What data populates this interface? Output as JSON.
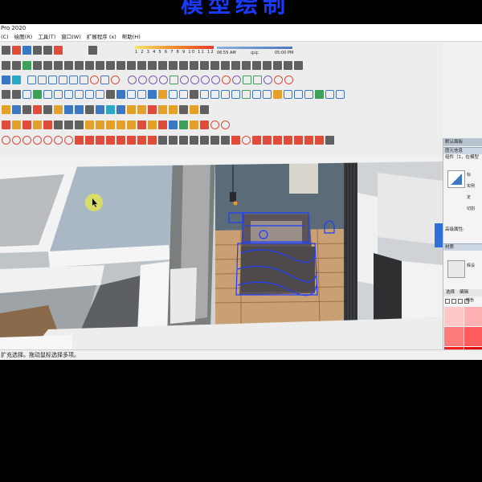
{
  "banner": {
    "text": "模型绘制"
  },
  "window": {
    "title": "Pro 2020"
  },
  "menu": [
    {
      "label": "(C)"
    },
    {
      "label": "绘图(R)"
    },
    {
      "label": "工具(T)"
    },
    {
      "label": "窗口(W)"
    },
    {
      "label": "扩展程序 (x)"
    },
    {
      "label": "帮助(H)"
    }
  ],
  "shadow": {
    "months": "1 2 3 4 5 6 7 8 9 10 11 12",
    "time_start": "06:55 AM",
    "noon": "中午",
    "time_end": "05:00 PM"
  },
  "status": {
    "text": "扩充选择。拖动鼠标选择多项。"
  },
  "tray": {
    "title": "默认面板",
    "entity_section": "图元信息",
    "component_label": "组件（1，在模型",
    "side_labels": [
      "标",
      "实例",
      "定",
      "切割"
    ],
    "advanced": "高级属性:",
    "material_section": "材质",
    "material_name": "辉设",
    "tabs": [
      "选择",
      "编辑"
    ],
    "material_list": "颜色"
  },
  "colors": {
    "accent": "#2f6fd8",
    "selection": "#1f3cff",
    "swatches": [
      "#ffc8c8",
      "#ffb0b0",
      "#ff7a7a",
      "#ff5c5c",
      "#ff1a1a",
      "#e00000",
      "#c80000",
      "#e23a3a",
      "#ff4b2b",
      "#ff7a3a"
    ]
  }
}
